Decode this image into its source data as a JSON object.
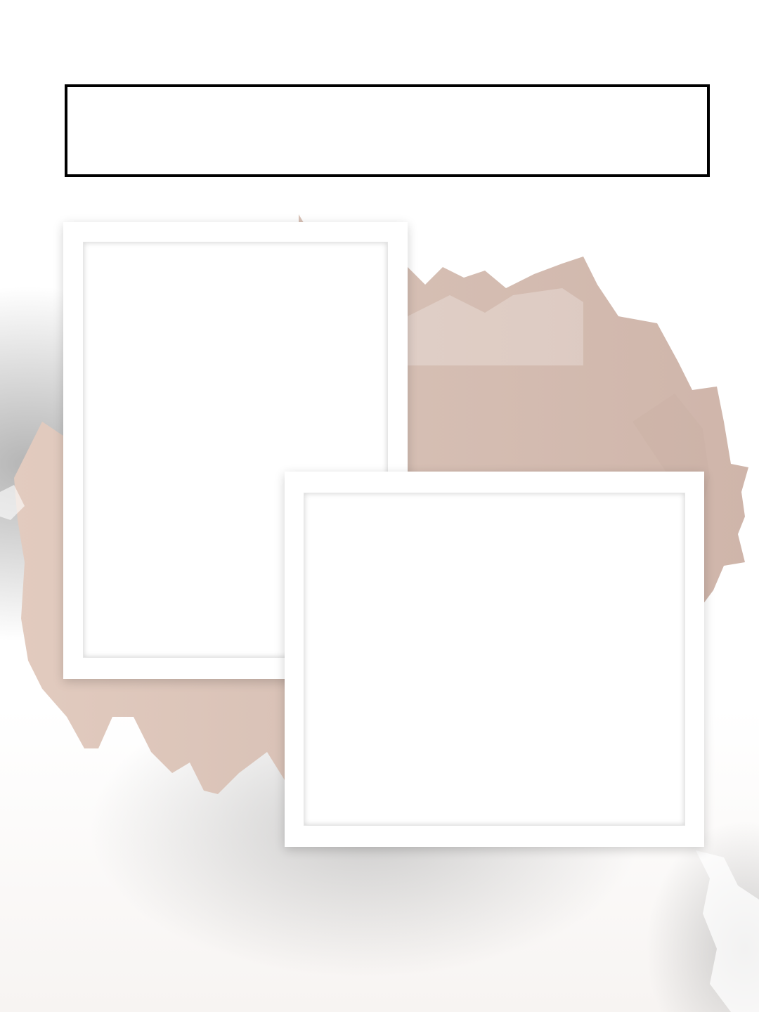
{
  "title_box": {
    "text": ""
  },
  "colors": {
    "paint": "#d9c3b8",
    "paint_dark": "#ccb1a5",
    "frame": "#ffffff",
    "border": "#000000"
  },
  "photo_frames": [
    {
      "label": ""
    },
    {
      "label": ""
    }
  ]
}
